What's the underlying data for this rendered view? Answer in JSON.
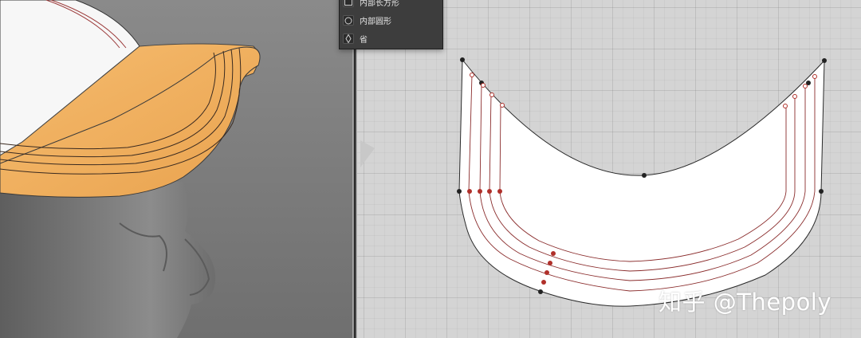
{
  "shape_menu": {
    "items": [
      {
        "label": "内部长方形",
        "icon": "rectangle-icon"
      },
      {
        "label": "内部圆形",
        "icon": "circle-icon"
      },
      {
        "label": "省",
        "icon": "dart-icon"
      }
    ]
  },
  "watermark": "知乎 @Thepoly",
  "colors": {
    "brim_fill": "#f2b05f",
    "crown_fill": "#f6f6f6",
    "panel_fill": "#ffffff",
    "stitch_line": "#8a2c2c",
    "point_dark": "#222222",
    "point_red": "#b0302a",
    "viewport_3d_bg": "#7d7d7d",
    "viewport_2d_bg": "#d4d4d4",
    "menu_bg": "#3d3d3d"
  }
}
